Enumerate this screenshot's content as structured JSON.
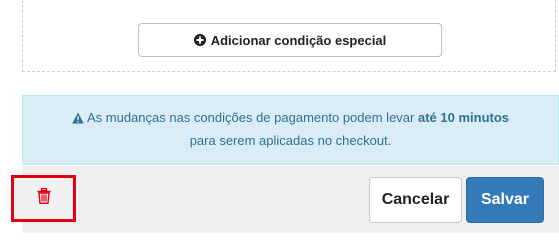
{
  "special_conditions": {
    "add_button_label": "Adicionar condição especial",
    "add_icon": "plus-circle-icon"
  },
  "notice": {
    "icon": "warning-triangle-icon",
    "text_before": "As mudanças nas condições de pagamento podem levar",
    "text_bold": "até 10 minutos",
    "text_after": "para serem aplicadas no checkout.",
    "color": "#31708f",
    "background": "#d9edf7"
  },
  "actions": {
    "delete_icon": "trash-icon",
    "delete_color": "#e3000f",
    "cancel_label": "Cancelar",
    "save_label": "Salvar",
    "save_color": "#337ab7"
  }
}
